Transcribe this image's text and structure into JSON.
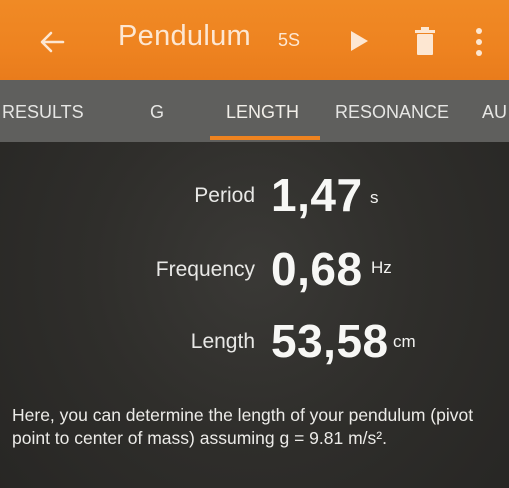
{
  "app_bar": {
    "title": "Pendulum",
    "duration": "5S",
    "icons": {
      "back": "arrow-back-icon",
      "play": "play-icon",
      "delete": "trash-icon",
      "more": "more-vert-icon"
    },
    "background_color": "#ee8320"
  },
  "tabs": [
    {
      "label": "RESULTS",
      "active": false
    },
    {
      "label": "G",
      "active": false
    },
    {
      "label": "LENGTH",
      "active": true
    },
    {
      "label": "RESONANCE",
      "active": false
    },
    {
      "label": "AU",
      "active": false
    }
  ],
  "measurements": {
    "period": {
      "label": "Period",
      "value": "1,47",
      "unit": "s"
    },
    "frequency": {
      "label": "Frequency",
      "value": "0,68",
      "unit": "Hz"
    },
    "length": {
      "label": "Length",
      "value": "53,58",
      "unit": "cm"
    }
  },
  "description": "Here, you can determine the length of your pendulum (pivot point to center of mass) assuming g = 9.81 m/s².",
  "colors": {
    "accent": "#ee8320",
    "tab_bar": "#5f5f5d",
    "content_bg": "#2f2e2b"
  }
}
